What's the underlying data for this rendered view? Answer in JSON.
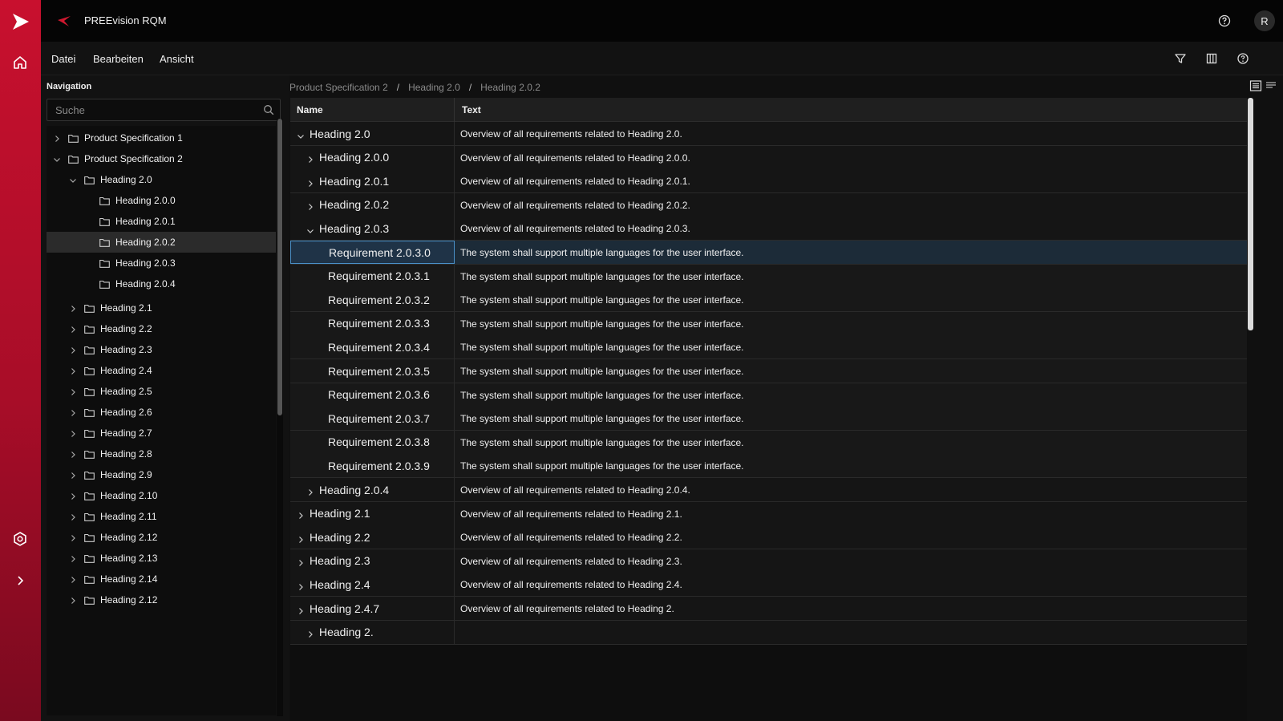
{
  "app": {
    "title": "PREEvision RQM",
    "avatar_initial": "R"
  },
  "menu": {
    "items": [
      "Datei",
      "Bearbeiten",
      "Ansicht"
    ]
  },
  "navigation": {
    "title": "Navigation",
    "search_placeholder": "Suche",
    "tree": [
      {
        "label": "Product Specification 1",
        "depth": 0,
        "expanded": false
      },
      {
        "label": "Product Specification 2",
        "depth": 0,
        "expanded": true
      },
      {
        "label": "Heading 2.0",
        "depth": 1,
        "expanded": true
      },
      {
        "label": "Heading 2.0.0",
        "depth": 2,
        "leaf": true
      },
      {
        "label": "Heading 2.0.1",
        "depth": 2,
        "leaf": true
      },
      {
        "label": "Heading 2.0.2",
        "depth": 2,
        "leaf": true,
        "selected": true
      },
      {
        "label": "Heading 2.0.3",
        "depth": 2,
        "leaf": true
      },
      {
        "label": "Heading 2.0.4",
        "depth": 2,
        "leaf": true
      },
      {
        "label": "Heading 2.1",
        "depth": 1,
        "expanded": false
      },
      {
        "label": "Heading 2.2",
        "depth": 1,
        "expanded": false
      },
      {
        "label": "Heading 2.3",
        "depth": 1,
        "expanded": false
      },
      {
        "label": "Heading 2.4",
        "depth": 1,
        "expanded": false
      },
      {
        "label": "Heading 2.5",
        "depth": 1,
        "expanded": false
      },
      {
        "label": "Heading 2.6",
        "depth": 1,
        "expanded": false
      },
      {
        "label": "Heading 2.7",
        "depth": 1,
        "expanded": false
      },
      {
        "label": "Heading 2.8",
        "depth": 1,
        "expanded": false
      },
      {
        "label": "Heading 2.9",
        "depth": 1,
        "expanded": false
      },
      {
        "label": "Heading 2.10",
        "depth": 1,
        "expanded": false
      },
      {
        "label": "Heading 2.11",
        "depth": 1,
        "expanded": false
      },
      {
        "label": "Heading 2.12",
        "depth": 1,
        "expanded": false
      },
      {
        "label": "Heading 2.13",
        "depth": 1,
        "expanded": false
      },
      {
        "label": "Heading 2.14",
        "depth": 1,
        "expanded": false
      },
      {
        "label": "Heading 2.12",
        "depth": 1,
        "expanded": false
      }
    ]
  },
  "breadcrumb": [
    "Product Specification 2",
    "Heading 2.0",
    "Heading 2.0.2"
  ],
  "grid": {
    "columns": [
      "Name",
      "Text"
    ],
    "rows": [
      {
        "name": "Heading 2.0",
        "text": "Overview of all requirements related to Heading 2.0.",
        "depth": 0,
        "chevron": "down"
      },
      {
        "name": "Heading 2.0.0",
        "text": "Overview of all requirements related to Heading 2.0.0.",
        "depth": 1,
        "chevron": "right"
      },
      {
        "name": "Heading 2.0.1",
        "text": "Overview of all requirements related to Heading 2.0.1.",
        "depth": 1,
        "chevron": "right"
      },
      {
        "name": "Heading 2.0.2",
        "text": "Overview of all requirements related to Heading 2.0.2.",
        "depth": 1,
        "chevron": "right"
      },
      {
        "name": "Heading 2.0.3",
        "text": "Overview of all requirements related to Heading 2.0.3.",
        "depth": 1,
        "chevron": "down"
      },
      {
        "name": "Requirement 2.0.3.0",
        "text": "The system shall support multiple languages for the user interface.",
        "depth": 2,
        "chevron": "none",
        "selected": true
      },
      {
        "name": "Requirement 2.0.3.1",
        "text": "The system shall support multiple languages for the user interface.",
        "depth": 2,
        "chevron": "none"
      },
      {
        "name": "Requirement 2.0.3.2",
        "text": "The system shall support multiple languages for the user interface.",
        "depth": 2,
        "chevron": "none"
      },
      {
        "name": "Requirement 2.0.3.3",
        "text": "The system shall support multiple languages for the user interface.",
        "depth": 2,
        "chevron": "none"
      },
      {
        "name": "Requirement 2.0.3.4",
        "text": "The system shall support multiple languages for the user interface.",
        "depth": 2,
        "chevron": "none"
      },
      {
        "name": "Requirement 2.0.3.5",
        "text": "The system shall support multiple languages for the user interface.",
        "depth": 2,
        "chevron": "none"
      },
      {
        "name": "Requirement 2.0.3.6",
        "text": "The system shall support multiple languages for the user interface.",
        "depth": 2,
        "chevron": "none"
      },
      {
        "name": "Requirement 2.0.3.7",
        "text": "The system shall support multiple languages for the user interface.",
        "depth": 2,
        "chevron": "none"
      },
      {
        "name": "Requirement 2.0.3.8",
        "text": "The system shall support multiple languages for the user interface.",
        "depth": 2,
        "chevron": "none"
      },
      {
        "name": "Requirement 2.0.3.9",
        "text": "The system shall support multiple languages for the user interface.",
        "depth": 2,
        "chevron": "none"
      },
      {
        "name": "Heading 2.0.4",
        "text": "Overview of all requirements related to Heading 2.0.4.",
        "depth": 1,
        "chevron": "right"
      },
      {
        "name": "Heading 2.1",
        "text": "Overview of all requirements related to Heading 2.1.",
        "depth": 0,
        "chevron": "right"
      },
      {
        "name": "Heading 2.2",
        "text": "Overview of all requirements related to Heading 2.2.",
        "depth": 0,
        "chevron": "right"
      },
      {
        "name": "Heading 2.3",
        "text": "Overview of all requirements related to Heading 2.3.",
        "depth": 0,
        "chevron": "right"
      },
      {
        "name": "Heading 2.4",
        "text": "Overview of all requirements related to Heading 2.4.",
        "depth": 0,
        "chevron": "right"
      },
      {
        "name": "Heading 2.4.7",
        "text": "Overview of all requirements related to Heading 2.",
        "depth": 0,
        "chevron": "right"
      },
      {
        "name": "Heading 2.",
        "text": "",
        "depth": 1,
        "chevron": "right"
      }
    ]
  },
  "colors": {
    "accent_red": "#c8102e",
    "selection_blue": "#4a90c8",
    "background": "#0b0b0b"
  },
  "icons": {
    "rail": [
      "app-logo-icon",
      "home-icon",
      "settings-icon",
      "expand-icon"
    ],
    "topbar": [
      "brand-icon",
      "help-icon"
    ],
    "toolbar": [
      "filter-icon",
      "columns-icon",
      "info-icon"
    ]
  }
}
